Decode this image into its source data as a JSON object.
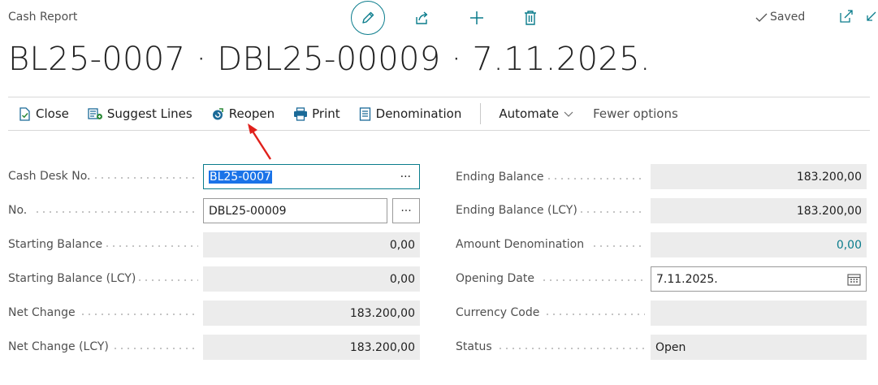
{
  "page": {
    "caption": "Cash Report",
    "title": "BL25-0007 · DBL25-00009 · 7.11.2025.",
    "saved": "Saved",
    "icons": [
      "pencil-icon",
      "share-icon",
      "plus-icon",
      "trash-icon",
      "open-new-window-icon",
      "collapse-icon"
    ]
  },
  "actions": {
    "close": "Close",
    "suggest_lines": "Suggest Lines",
    "reopen": "Reopen",
    "print": "Print",
    "denomination": "Denomination",
    "automate": "Automate",
    "fewer_options": "Fewer options"
  },
  "left_fields": {
    "cash_desk_no": {
      "label": "Cash Desk No.",
      "value": "BL25-0007"
    },
    "no": {
      "label": "No.",
      "value": "DBL25-00009"
    },
    "starting_balance": {
      "label": "Starting Balance",
      "value": "0,00"
    },
    "starting_balance_lcy": {
      "label": "Starting Balance (LCY)",
      "value": "0,00"
    },
    "net_change": {
      "label": "Net Change",
      "value": "183.200,00"
    },
    "net_change_lcy": {
      "label": "Net Change (LCY)",
      "value": "183.200,00"
    }
  },
  "right_fields": {
    "ending_balance": {
      "label": "Ending Balance",
      "value": "183.200,00"
    },
    "ending_balance_lcy": {
      "label": "Ending Balance (LCY)",
      "value": "183.200,00"
    },
    "amount_denomination": {
      "label": "Amount Denomination",
      "value": "0,00"
    },
    "opening_date": {
      "label": "Opening Date",
      "value": "7.11.2025."
    },
    "currency_code": {
      "label": "Currency Code",
      "value": ""
    },
    "status": {
      "label": "Status",
      "value": "Open"
    }
  },
  "assist_ellipsis": "···",
  "colors": {
    "accent": "#0a7c8c",
    "selection": "#1a73e8",
    "readonly_bg": "#ececec",
    "annotation_arrow": "#e0201b"
  }
}
